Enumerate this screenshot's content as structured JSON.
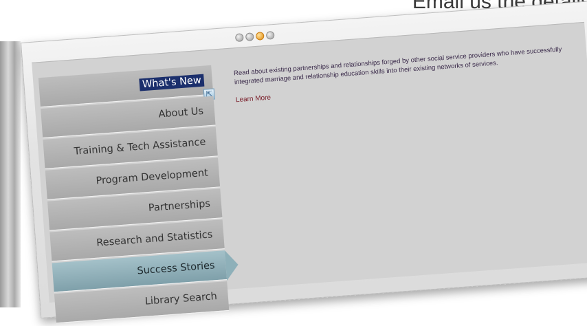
{
  "header": {
    "headline": "Email us the details"
  },
  "carousel": {
    "dots": 4,
    "active_index": 2
  },
  "nav": {
    "items": [
      {
        "label": "What's New",
        "highlighted": true
      },
      {
        "label": "About Us"
      },
      {
        "label": "Training & Tech Assistance"
      },
      {
        "label": "Program Development"
      },
      {
        "label": "Partnerships"
      },
      {
        "label": "Research and Statistics"
      },
      {
        "label": "Success Stories",
        "active": true
      },
      {
        "label": "Library Search"
      }
    ]
  },
  "content": {
    "description": "Read about existing partnerships and relationships forged by other social service providers who have successfully integrated marriage and relationship education skills into their existing networks of services.",
    "link_label": "Learn More"
  },
  "colors": {
    "highlight_bg": "#1b2f6c",
    "active_tab": "#8eb0b9",
    "link": "#7a1e2a"
  }
}
